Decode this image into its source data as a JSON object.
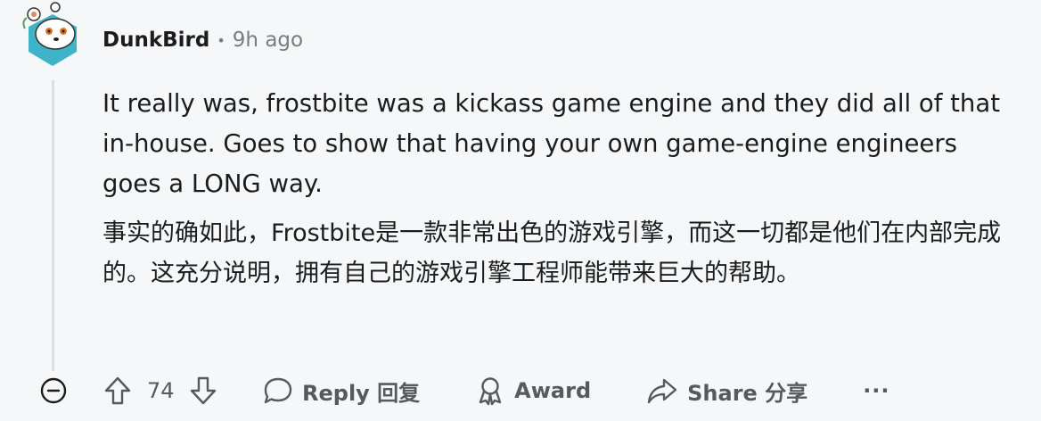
{
  "comment": {
    "username": "DunkBird",
    "separator": "•",
    "timestamp": "9h ago",
    "body_en": "It really was, frostbite was a kickass game engine and they did all of that in-house. Goes to show that having your own game-engine engineers goes a LONG way.",
    "body_zh": "事实的确如此，Frostbite是一款非常出色的游戏引擎，而这一切都是他们在内部完成的。这充分说明，拥有自己的游戏引擎工程师能带来巨大的帮助。"
  },
  "actions": {
    "vote_count": "74",
    "reply_label": "Reply 回复",
    "award_label": "Award",
    "share_label": "Share 分享",
    "more_label": "···"
  },
  "icons": {
    "avatar": "snoo-avatar-icon",
    "collapse": "collapse-minus-icon",
    "upvote": "upvote-arrow-icon",
    "downvote": "downvote-arrow-icon",
    "reply": "speech-bubble-icon",
    "award": "award-icon",
    "share": "share-arrow-icon"
  },
  "colors": {
    "background": "#f6f7f8",
    "text": "#1c1c1c",
    "muted": "#7c7c7c",
    "action": "#57595c",
    "avatar_teal": "#3fb3c8"
  }
}
